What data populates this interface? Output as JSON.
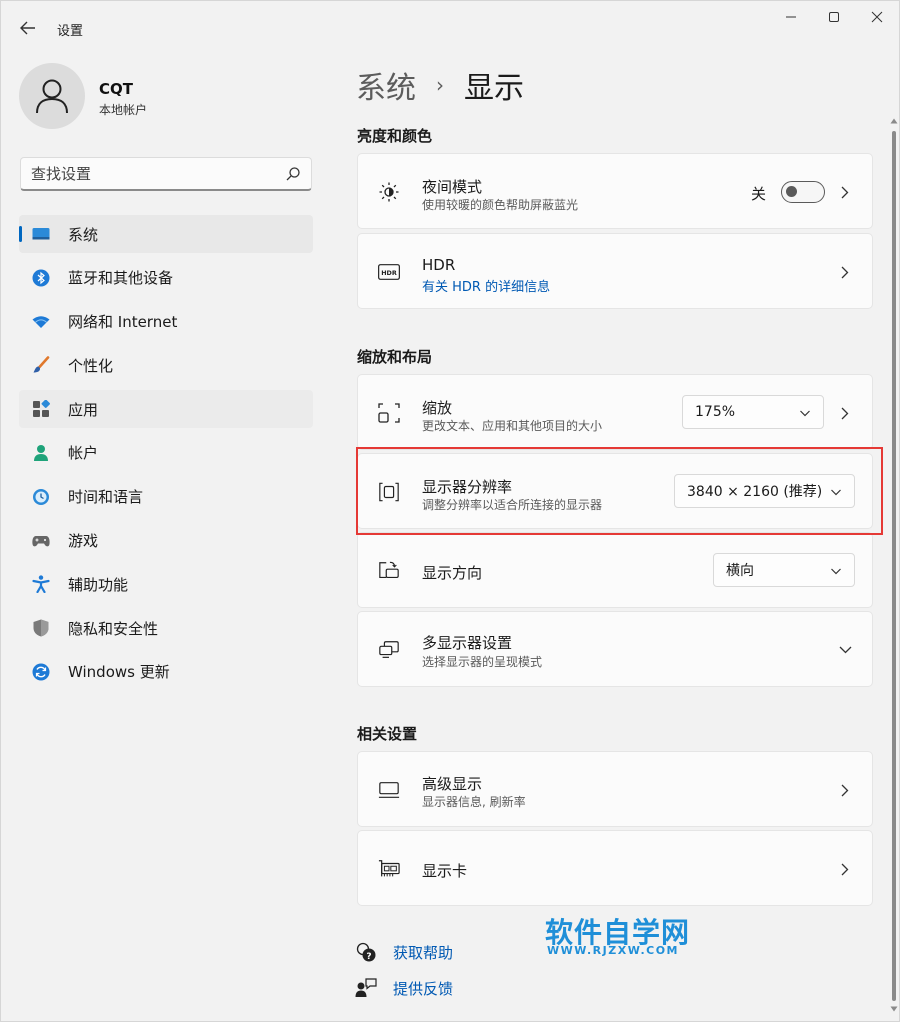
{
  "window": {
    "title": "设置",
    "back_icon": "arrow-left-icon",
    "controls": {
      "minimize_icon": "minimize-icon",
      "maximize_icon": "maximize-icon",
      "close_icon": "close-icon"
    }
  },
  "profile": {
    "name": "CQT",
    "subtitle": "本地帐户",
    "icon": "user-avatar-icon"
  },
  "search": {
    "placeholder": "查找设置",
    "value": "",
    "icon": "search-icon"
  },
  "nav": {
    "items": [
      {
        "label": "系统",
        "icon": "system-icon",
        "active": true
      },
      {
        "label": "蓝牙和其他设备",
        "icon": "bluetooth-icon"
      },
      {
        "label": "网络和 Internet",
        "icon": "wifi-icon"
      },
      {
        "label": "个性化",
        "icon": "brush-icon"
      },
      {
        "label": "应用",
        "icon": "apps-icon"
      },
      {
        "label": "帐户",
        "icon": "account-icon"
      },
      {
        "label": "时间和语言",
        "icon": "clock-globe-icon"
      },
      {
        "label": "游戏",
        "icon": "gamepad-icon"
      },
      {
        "label": "辅助功能",
        "icon": "accessibility-icon"
      },
      {
        "label": "隐私和安全性",
        "icon": "shield-icon"
      },
      {
        "label": "Windows 更新",
        "icon": "update-icon"
      }
    ]
  },
  "breadcrumb": {
    "parent": "系统",
    "separator": "›",
    "current": "显示"
  },
  "sections": {
    "brightness": {
      "title": "亮度和颜色",
      "night_light": {
        "title": "夜间模式",
        "subtitle": "使用较暖的颜色帮助屏蔽蓝光",
        "toggle_label": "关",
        "toggle_on": false,
        "icon": "brightness-icon"
      },
      "hdr": {
        "title": "HDR",
        "link": "有关 HDR 的详细信息",
        "icon": "hdr-icon"
      }
    },
    "scale_layout": {
      "title": "缩放和布局",
      "scale": {
        "title": "缩放",
        "subtitle": "更改文本、应用和其他项目的大小",
        "value": "175%",
        "icon": "scale-icon"
      },
      "resolution": {
        "title": "显示器分辨率",
        "subtitle": "调整分辨率以适合所连接的显示器",
        "value": "3840 × 2160 (推荐)",
        "icon": "resolution-icon"
      },
      "orientation": {
        "title": "显示方向",
        "value": "横向",
        "icon": "orientation-icon"
      },
      "multi_display": {
        "title": "多显示器设置",
        "subtitle": "选择显示器的呈现模式",
        "icon": "multi-display-icon"
      }
    },
    "related": {
      "title": "相关设置",
      "advanced_display": {
        "title": "高级显示",
        "subtitle": "显示器信息, 刷新率",
        "icon": "monitor-icon"
      },
      "graphics": {
        "title": "显示卡",
        "icon": "graphics-card-icon"
      }
    }
  },
  "help": {
    "get_help": "获取帮助",
    "feedback": "提供反馈"
  },
  "watermark": {
    "main": "软件自学网",
    "sub": "WWW.RJZXW.COM"
  },
  "colors": {
    "accent": "#0067c0",
    "link": "#0059b3",
    "highlight_box": "#e53935",
    "watermark": "#1f8fd8"
  }
}
